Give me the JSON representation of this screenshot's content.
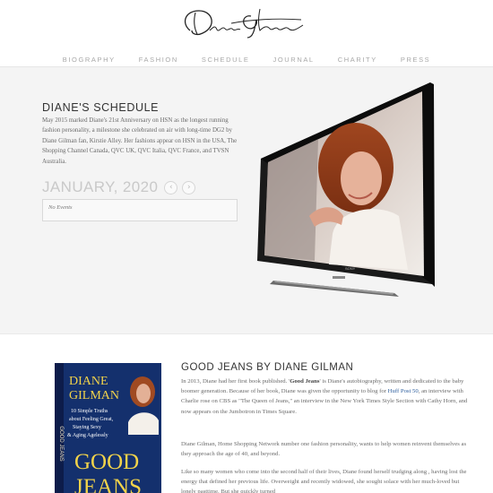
{
  "header": {
    "logo_alt": "Diane Gilman signature logo",
    "nav": [
      "BIOGRAPHY",
      "FASHION",
      "SCHEDULE",
      "JOURNAL",
      "CHARITY",
      "PRESS"
    ]
  },
  "schedule": {
    "title": "DIANE'S SCHEDULE",
    "text": "May 2015 marked Diane's 21st Anniversary on HSN as the longest running fashion personality, a milestone she celebrated on air with long-time DG2 by Diane Gilman fan, Kirstie Alley. Her fashions appear on HSN in the USA, The Shopping Channel Canada, QVC UK, QVC Italia, QVC France, and TVSN Australia.",
    "month": "JANUARY, 2020",
    "prev_icon": "chevron-left-icon",
    "next_icon": "chevron-right-icon",
    "no_events": "No Events"
  },
  "tv": {
    "brand": "SONY"
  },
  "book": {
    "cover": {
      "author_line1": "DIANE",
      "author_line2": "GILMAN",
      "tagline": "10 Simple Truths about Feeling Great, Staying Sexy & Aging Agelessly",
      "title_line1": "GOOD",
      "title_line2": "JEANS",
      "spine": "GOOD JEANS"
    },
    "title": "GOOD JEANS BY DIANE GILMAN",
    "p1_a": "In 2013, Diane had her first book published. '",
    "p1_bold": "Good Jeans",
    "p1_b": "' is Diane's autobiography, written and dedicated to the baby boomer generation. Because of her book, Diane was given the opportunity to blog for ",
    "p1_link": "Huff Post 50",
    "p1_c": ", an interview with Charlie rose on CBS as \"The Queen of Jeans,\" an interview in the New York Times Style Section with Cathy Horn, and now appears on the Jumbotron in Times Square.",
    "p2": "Diane Gilman, Home Shopping Network number one fashion personality, wants to help women reinvent themselves as they approach the age of 40, and beyond.",
    "p3": "Like so many women who come into the second half of their lives, Diane found herself trudging along , having lost the energy that defined her previous life. Overweight and recently widowed, she sought solace with her much-loved but lonely pasttime. But she quickly turned"
  }
}
